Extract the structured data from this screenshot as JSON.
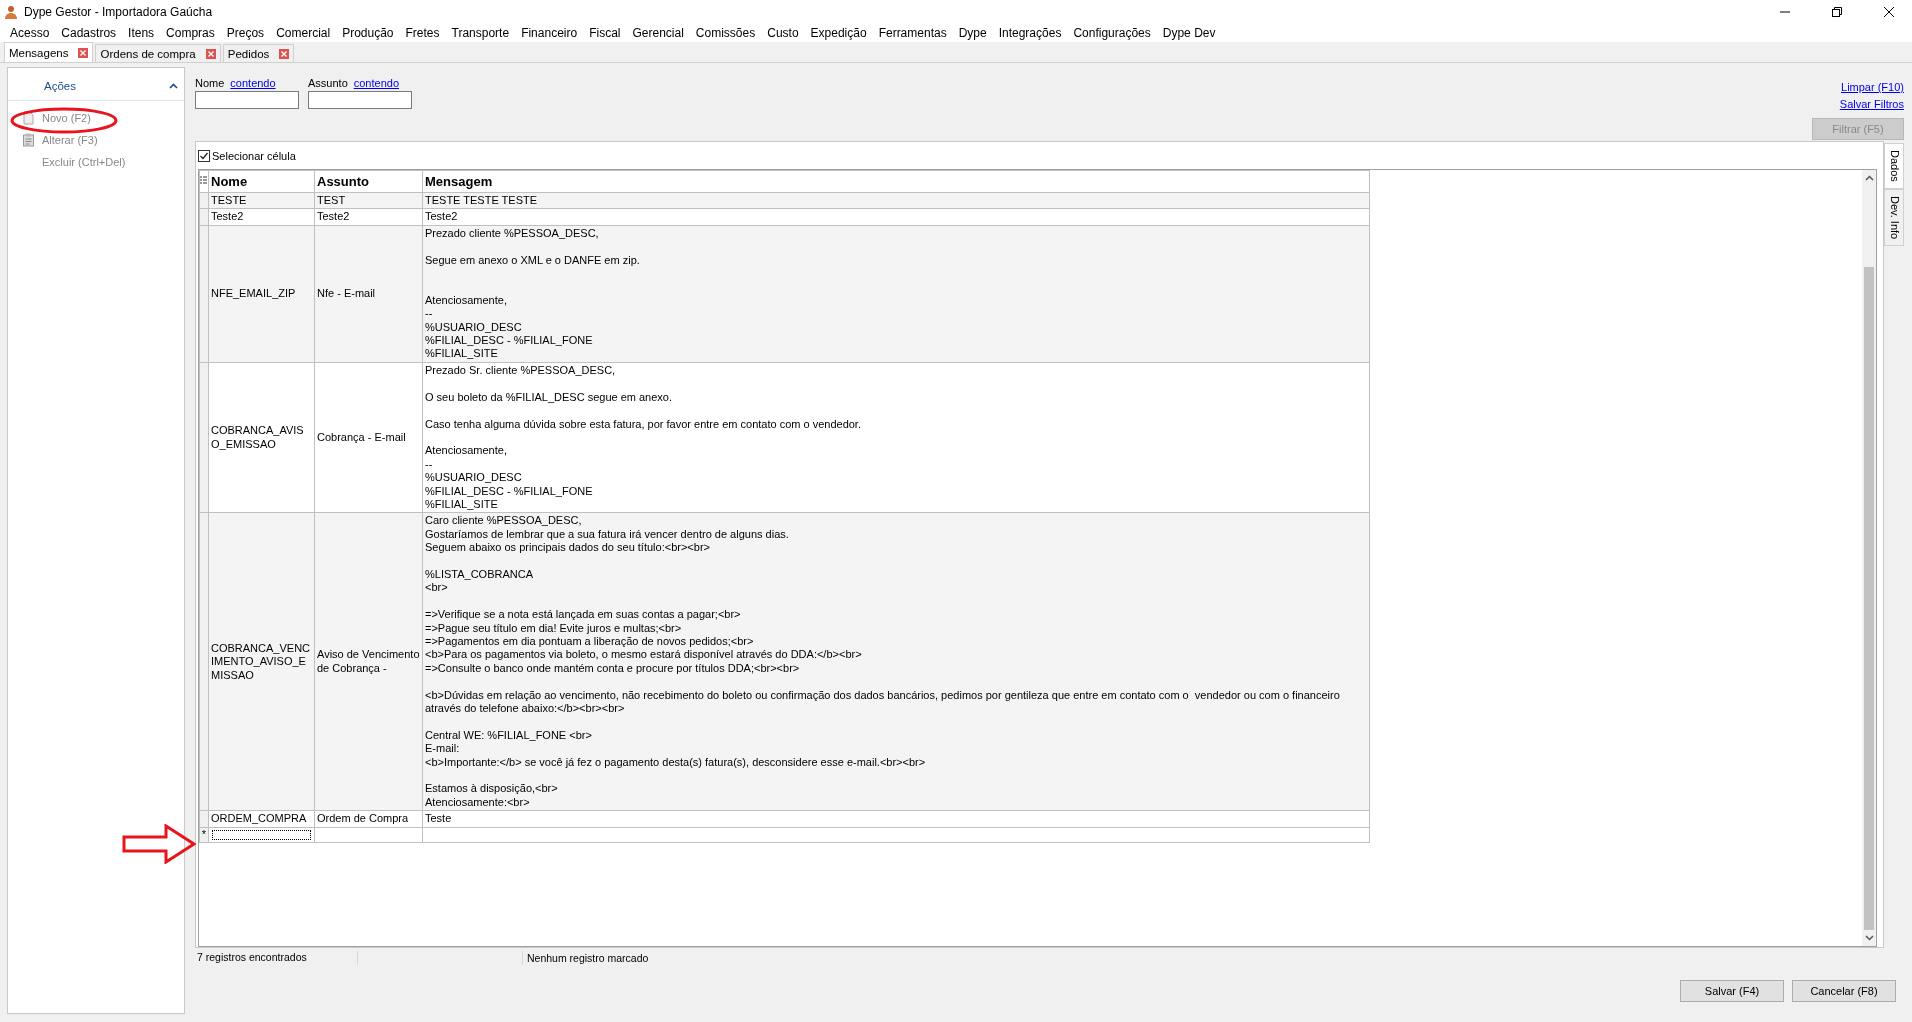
{
  "window": {
    "title": "Dype Gestor - Importadora Gaúcha"
  },
  "menu": [
    "Acesso",
    "Cadastros",
    "Itens",
    "Compras",
    "Preços",
    "Comercial",
    "Produção",
    "Fretes",
    "Transporte",
    "Financeiro",
    "Fiscal",
    "Gerencial",
    "Comissões",
    "Custo",
    "Expedição",
    "Ferramentas",
    "Dype",
    "Integrações",
    "Configurações",
    "Dype Dev"
  ],
  "tabs": [
    {
      "label": "Mensagens",
      "selected": true
    },
    {
      "label": "Ordens de compra",
      "selected": false
    },
    {
      "label": "Pedidos",
      "selected": false
    }
  ],
  "actions": {
    "title": "Ações",
    "items": [
      {
        "label": "Novo (F2)",
        "kind": "new",
        "disabled": true
      },
      {
        "label": "Alterar (F3)",
        "kind": "edit",
        "disabled": true
      },
      {
        "label": "Excluir (Ctrl+Del)",
        "kind": "plain",
        "disabled": true
      }
    ]
  },
  "filters": [
    {
      "label": "Nome",
      "link": "contendo"
    },
    {
      "label": "Assunto",
      "link": "contendo"
    }
  ],
  "filter_links": [
    "Limpar (F10)",
    "Salvar Filtros"
  ],
  "filter_button": {
    "label": "Filtrar (F5)",
    "disabled": true
  },
  "grid": {
    "select_cell": {
      "label": "Selecionar célula",
      "checked": true
    },
    "columns": [
      "Nome",
      "Assunto",
      "Mensagem"
    ],
    "rows": [
      {
        "cells": [
          "TESTE",
          "TEST",
          "TESTE TESTE TESTE"
        ]
      },
      {
        "cells": [
          "Teste2",
          "Teste2",
          "Teste2"
        ]
      },
      {
        "cells": [
          "NFE_EMAIL_ZIP",
          "Nfe - E-mail",
          "Prezado cliente %PESSOA_DESC,\n\nSegue em anexo o XML e o DANFE em zip.\n\n\nAtenciosamente,\n--\n%USUARIO_DESC\n%FILIAL_DESC - %FILIAL_FONE\n%FILIAL_SITE"
        ]
      },
      {
        "cells": [
          "COBRANCA_AVISO_EMISSAO",
          "Cobrança - E-mail",
          "Prezado Sr. cliente %PESSOA_DESC,\n\nO seu boleto da %FILIAL_DESC segue em anexo.\n\nCaso tenha alguma dúvida sobre esta fatura, por favor entre em contato com o vendedor.\n\nAtenciosamente,\n--\n%USUARIO_DESC\n%FILIAL_DESC - %FILIAL_FONE\n%FILIAL_SITE"
        ]
      },
      {
        "cells": [
          "COBRANCA_VENCIMENTO_AVISO_EMISSAO",
          "Aviso de Vencimento de Cobrança -",
          "Caro cliente %PESSOA_DESC,\nGostaríamos de lembrar que a sua fatura irá vencer dentro de alguns dias.\nSeguem abaixo os principais dados do seu título:<br><br>\n\n%LISTA_COBRANCA\n<br>\n\n=>Verifique se a nota está lançada em suas contas a pagar;<br>\n=>Pague seu título em dia! Evite juros e multas;<br>\n=>Pagamentos em dia pontuam a liberação de novos pedidos;<br>\n<b>Para os pagamentos via boleto, o mesmo estará disponível através do DDA:</b><br>\n=>Consulte o banco onde mantém conta e procure por títulos DDA;<br><br>\n\n<b>Dúvidas em relação ao vencimento, não recebimento do boleto ou confirmação dos dados bancários, pedimos por gentileza que entre em contato com o  vendedor ou com o financeiro através do telefone abaixo:</b><br><br>\n\nCentral WE: %FILIAL_FONE <br>\nE-mail:\n<b>Importante:</b> se você já fez o pagamento desta(s) fatura(s), desconsidere esse e-mail.<br><br>\n\nEstamos à disposição,<br>\nAtenciosamente:<br>"
        ]
      },
      {
        "cells": [
          "ORDEM_COMPRA",
          "Ordem de Compra",
          "Teste"
        ]
      }
    ],
    "new_row": {
      "indicator": "*"
    },
    "side_tabs": [
      {
        "label": "Dados",
        "selected": true
      },
      {
        "label": "Dev. Info",
        "selected": false
      }
    ]
  },
  "status_bar": [
    "7 registros encontrados",
    "Nenhum registro marcado"
  ],
  "buttons": [
    "Salvar (F4)",
    "Cancelar (F8)"
  ]
}
